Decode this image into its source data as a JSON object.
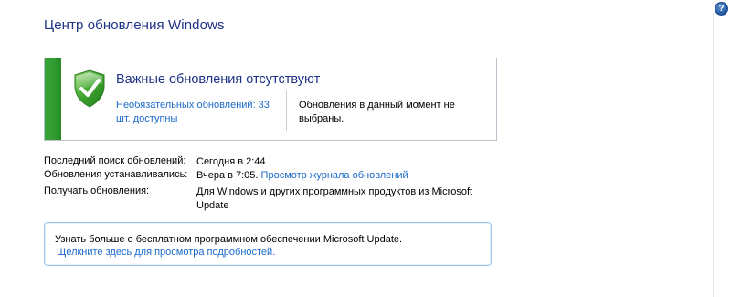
{
  "header": {
    "title": "Центр обновления Windows",
    "help_icon_glyph": "?"
  },
  "status": {
    "heading": "Важные обновления отсутствуют",
    "optional_link": "Необязательных обновлений: 33 шт. доступны",
    "selected_text": "Обновления в данный момент не выбраны.",
    "stripe_color": "#2f9a2f",
    "icon": "shield-check-icon"
  },
  "info": {
    "rows": [
      {
        "label": "Последний поиск обновлений:",
        "value": "Сегодня в 2:44"
      },
      {
        "label": "Обновления устанавливались:",
        "value": "Вчера в 7:05.",
        "link": "Просмотр журнала обновлений"
      },
      {
        "label": "Получать обновления:",
        "value": "Для Windows и других программных продуктов из Microsoft Update"
      }
    ]
  },
  "info_box": {
    "text": "Узнать больше о бесплатном программном обеспечении Microsoft Update.",
    "link": "Щелкните здесь для просмотра подробностей."
  },
  "colors": {
    "title": "#1e3287",
    "link": "#1b6ac9",
    "panel_border": "#b9c3ce",
    "info_box_border": "#9fc3e6"
  }
}
